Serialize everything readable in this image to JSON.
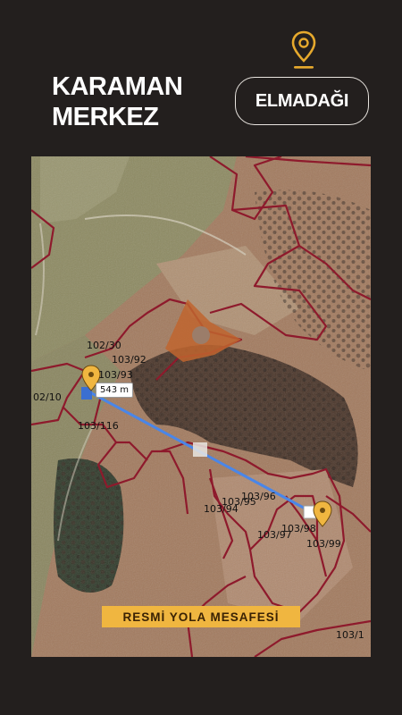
{
  "header": {
    "title_line1": "KARAMAN",
    "title_line2": "MERKEZ",
    "location_button": "ELMADAĞI",
    "pin_icon": "map-pin-icon"
  },
  "map": {
    "distance_label": "543 m",
    "banner": "RESMİ YOLA MESAFESİ",
    "parcels": [
      "102/30",
      "103/92",
      "103/93",
      "02/10",
      "103/116",
      "103/96",
      "103/95",
      "103/94",
      "103/98",
      "103/97",
      "103/99",
      "103/1"
    ],
    "colors": {
      "boundary": "#8e1a2c",
      "route": "#4a86e8",
      "marker": "#f0b640",
      "banner": "#f0b640"
    }
  }
}
